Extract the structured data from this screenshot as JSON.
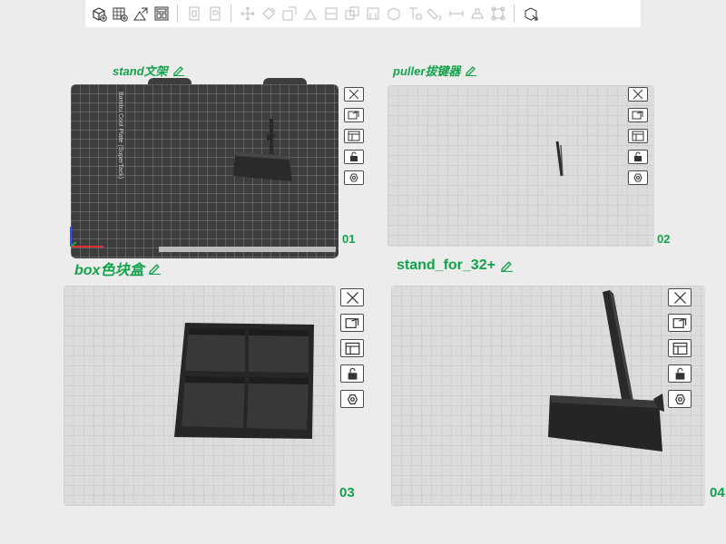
{
  "toolbar": {
    "items": [
      {
        "icon": "add-cube-icon",
        "group": 1
      },
      {
        "icon": "add-plate-icon",
        "group": 1
      },
      {
        "icon": "auto-orient-icon",
        "group": 1
      },
      {
        "icon": "arrange-icon",
        "group": 1
      },
      {
        "icon": "split-to-objects-icon",
        "group": 2
      },
      {
        "icon": "split-to-parts-icon",
        "group": 2
      },
      {
        "icon": "move-icon",
        "group": 3
      },
      {
        "icon": "rotate-icon",
        "group": 3
      },
      {
        "icon": "scale-icon",
        "group": 3
      },
      {
        "icon": "lay-on-face-icon",
        "group": 3
      },
      {
        "icon": "cut-icon",
        "group": 3
      },
      {
        "icon": "boolean-icon",
        "group": 3
      },
      {
        "icon": "support-paint-icon",
        "group": 3
      },
      {
        "icon": "seam-paint-icon",
        "group": 3
      },
      {
        "icon": "text-emboss-icon",
        "group": 3
      },
      {
        "icon": "color-paint-icon",
        "group": 3
      },
      {
        "icon": "measure-icon",
        "group": 3
      },
      {
        "icon": "assembly-icon",
        "group": 3
      },
      {
        "icon": "brim-ears-icon",
        "group": 3
      },
      {
        "icon": "assembly-view-icon",
        "group": 4
      }
    ]
  },
  "plates": [
    {
      "name": "stand文架",
      "number": "01",
      "active": true,
      "bed_label": "Bambu Cool Plate (SuperTack)"
    },
    {
      "name": "puller拔键器",
      "number": "02",
      "active": false
    },
    {
      "name": "box色块盒",
      "number": "03",
      "active": false
    },
    {
      "name": "stand_for_32+",
      "number": "04",
      "active": false
    }
  ],
  "plate_tools": [
    "remove-plate-icon",
    "auto-arrange-plate-icon",
    "plate-settings-icon",
    "lock-plate-icon",
    "orient-plate-icon"
  ],
  "colors": {
    "accent": "#12a24a",
    "model": "#2a2a2a",
    "bed_dark": "#3d3d3d",
    "bed_light": "#dcdcdc"
  }
}
